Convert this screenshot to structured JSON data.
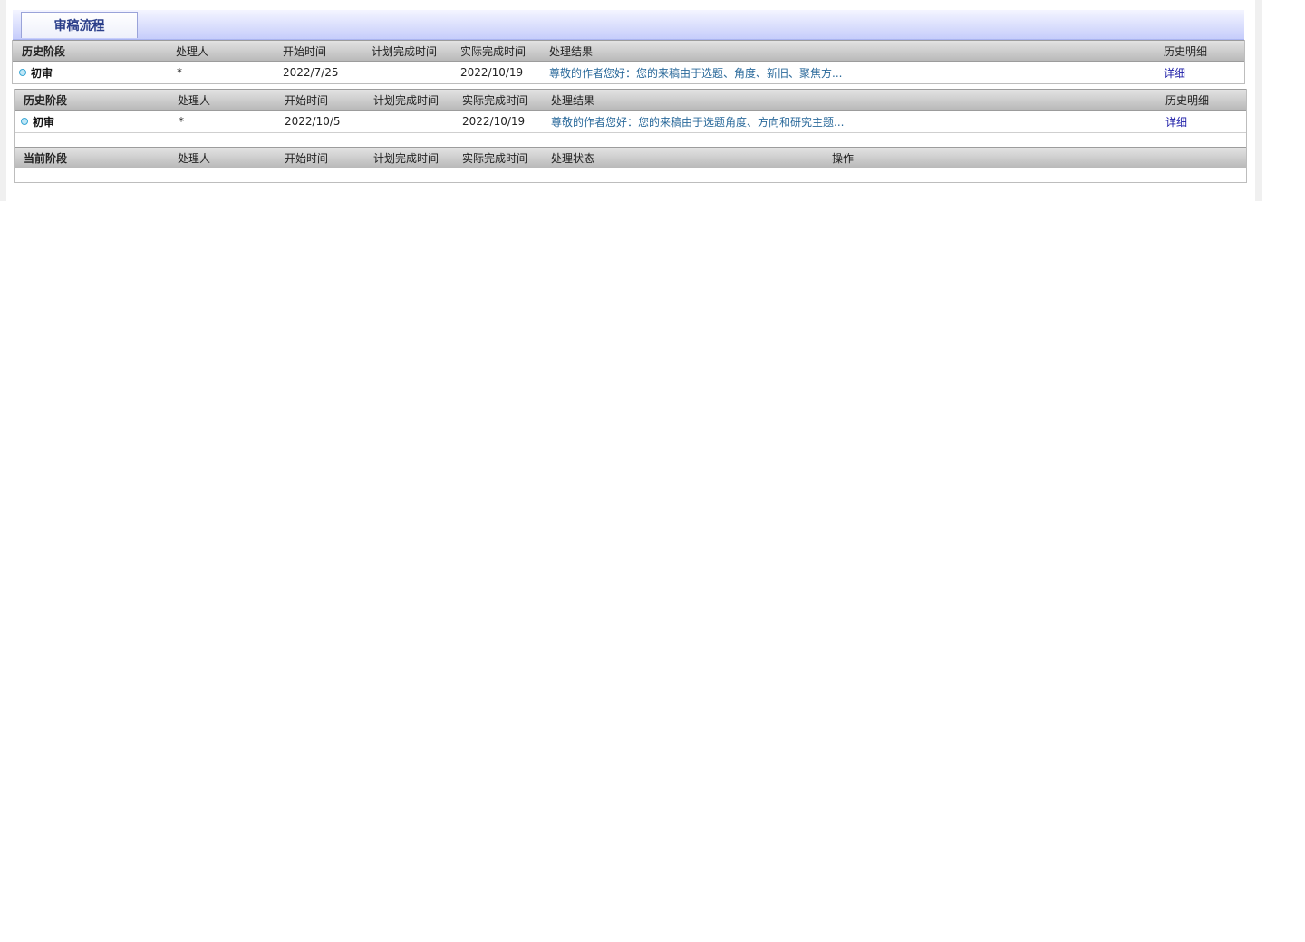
{
  "tab": {
    "label": "审稿流程"
  },
  "history_columns": {
    "stage": "历史阶段",
    "handler": "处理人",
    "start": "开始时间",
    "planned": "计划完成时间",
    "actual": "实际完成时间",
    "result": "处理结果",
    "detail": "历史明细"
  },
  "history_tables": [
    {
      "rows": [
        {
          "stage": "初审",
          "handler": "*",
          "start": "2022/7/25",
          "planned": "",
          "actual": "2022/10/19",
          "result": "尊敬的作者您好：您的来稿由于选题、角度、新旧、聚焦方...",
          "detail": "详细"
        }
      ]
    },
    {
      "rows": [
        {
          "stage": "初审",
          "handler": "*",
          "start": "2022/10/5",
          "planned": "",
          "actual": "2022/10/19",
          "result": "尊敬的作者您好：您的来稿由于选题角度、方向和研究主题...",
          "detail": "详细"
        }
      ]
    }
  ],
  "current_columns": {
    "stage": "当前阶段",
    "handler": "处理人",
    "start": "开始时间",
    "planned": "计划完成时间",
    "actual": "实际完成时间",
    "status": "处理状态",
    "action": "操作"
  },
  "icons": {
    "row_bullet": "circle-bullet-icon"
  },
  "colors": {
    "tab_text": "#2b3f8a",
    "result_link": "#2b6a9b",
    "detail_link": "#1a1aa6"
  }
}
